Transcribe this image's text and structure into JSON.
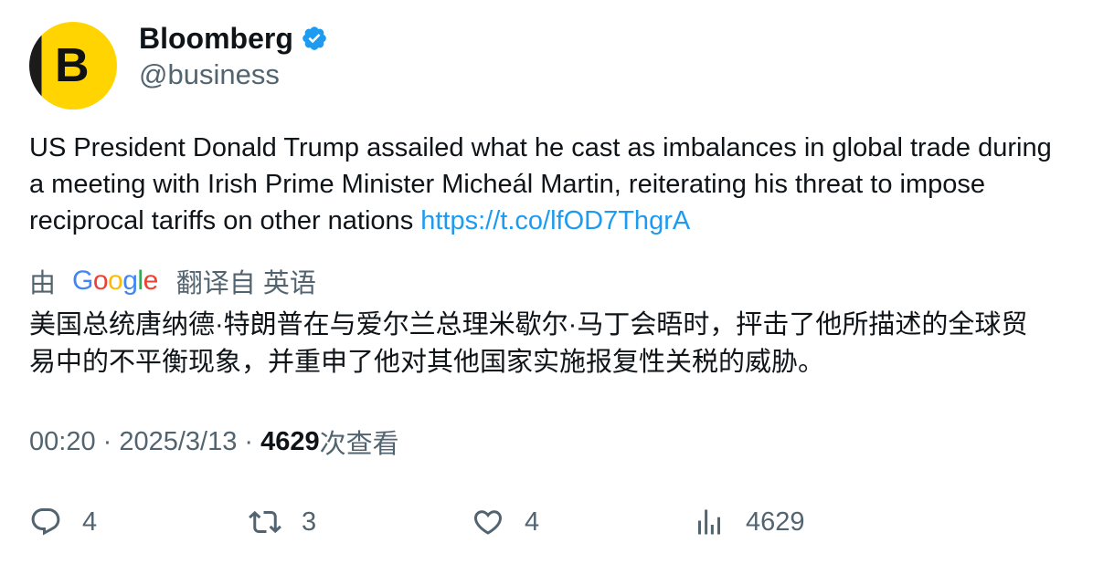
{
  "author": {
    "display_name": "Bloomberg",
    "handle": "@business",
    "avatar_letter": "B",
    "avatar_colors": {
      "primary": "#ffd400",
      "secondary": "#1b1b1b"
    },
    "verified_icon": "verified-badge-icon",
    "verified_color": "#1d9bf0"
  },
  "tweet": {
    "text": "US President Donald Trump assailed what he cast as imbalances in global trade during a meeting with Irish Prime Minister Micheál Martin, reiterating his threat to impose reciprocal tariffs on other nations ",
    "link": "https://t.co/lfOD7ThgrA",
    "link_color": "#1d9bf0"
  },
  "translation": {
    "by_label": "由",
    "provider": "Google",
    "from_label": "翻译自 英语",
    "text": "美国总统唐纳德·特朗普在与爱尔兰总理米歇尔·马丁会晤时，抨击了他所描述的全球贸易中的不平衡现象，并重申了他对其他国家实施报复性关税的威胁。"
  },
  "meta": {
    "time": "00:20",
    "separator": " · ",
    "date": "2025/3/13",
    "views": "4629",
    "views_label": "次查看"
  },
  "actions": {
    "reply": {
      "icon": "reply-icon",
      "count": "4"
    },
    "retweet": {
      "icon": "retweet-icon",
      "count": "3"
    },
    "like": {
      "icon": "heart-icon",
      "count": "4"
    },
    "views": {
      "icon": "analytics-icon",
      "count": "4629"
    }
  }
}
